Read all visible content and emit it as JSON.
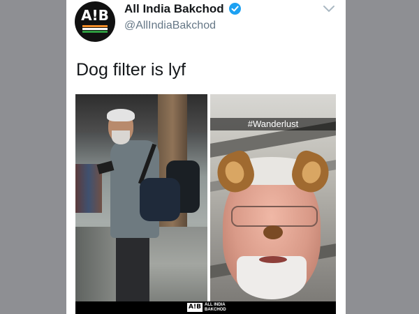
{
  "tweet": {
    "avatar_text": "A!B",
    "display_name": "All India Bakchod",
    "handle": "@AllIndiaBakchod",
    "text": "Dog filter is lyf",
    "verified": true
  },
  "icons": {
    "verified": "verified-badge-icon",
    "menu": "chevron-down-icon"
  },
  "media": {
    "snap_caption": "#Wanderlust",
    "footer_logo": "A!B",
    "footer_text": "ALL INDIA BAKCHOD"
  },
  "colors": {
    "verified": "#1da1f2",
    "background": "#8e8f93",
    "text_primary": "#14171a",
    "text_secondary": "#657786"
  }
}
